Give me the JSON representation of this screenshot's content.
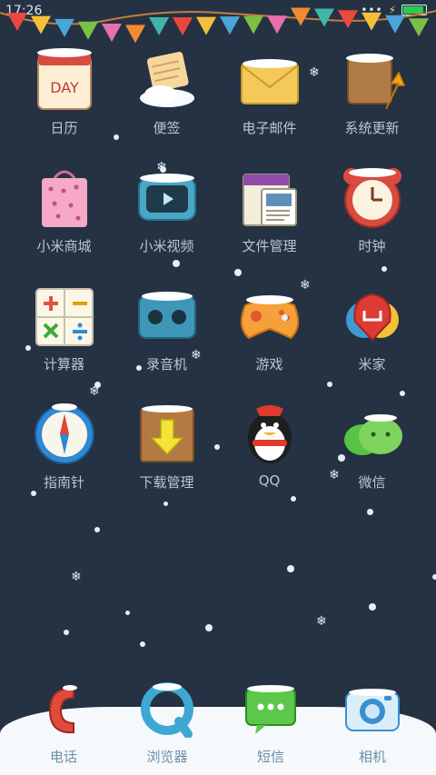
{
  "status": {
    "time": "17:26",
    "signal_dots": "•••",
    "battery_level_percent": 90
  },
  "apps": [
    {
      "label": "日历",
      "icon": "calendar-icon",
      "card_text": "DAY"
    },
    {
      "label": "便签",
      "icon": "notes-icon"
    },
    {
      "label": "电子邮件",
      "icon": "email-icon"
    },
    {
      "label": "系统更新",
      "icon": "system-update-icon"
    },
    {
      "label": "小米商城",
      "icon": "shopping-bag-icon"
    },
    {
      "label": "小米视频",
      "icon": "tv-icon"
    },
    {
      "label": "文件管理",
      "icon": "folder-icon"
    },
    {
      "label": "时钟",
      "icon": "alarm-clock-icon"
    },
    {
      "label": "计算器",
      "icon": "calculator-icon"
    },
    {
      "label": "录音机",
      "icon": "recorder-icon"
    },
    {
      "label": "游戏",
      "icon": "gamepad-icon"
    },
    {
      "label": "米家",
      "icon": "mi-home-icon"
    },
    {
      "label": "指南针",
      "icon": "compass-icon"
    },
    {
      "label": "下载管理",
      "icon": "download-icon"
    },
    {
      "label": "QQ",
      "icon": "penguin-icon"
    },
    {
      "label": "微信",
      "icon": "wechat-icon"
    }
  ],
  "dock": [
    {
      "label": "电话",
      "icon": "phone-icon"
    },
    {
      "label": "浏览器",
      "icon": "browser-icon"
    },
    {
      "label": "短信",
      "icon": "message-icon"
    },
    {
      "label": "相机",
      "icon": "camera-icon"
    }
  ]
}
